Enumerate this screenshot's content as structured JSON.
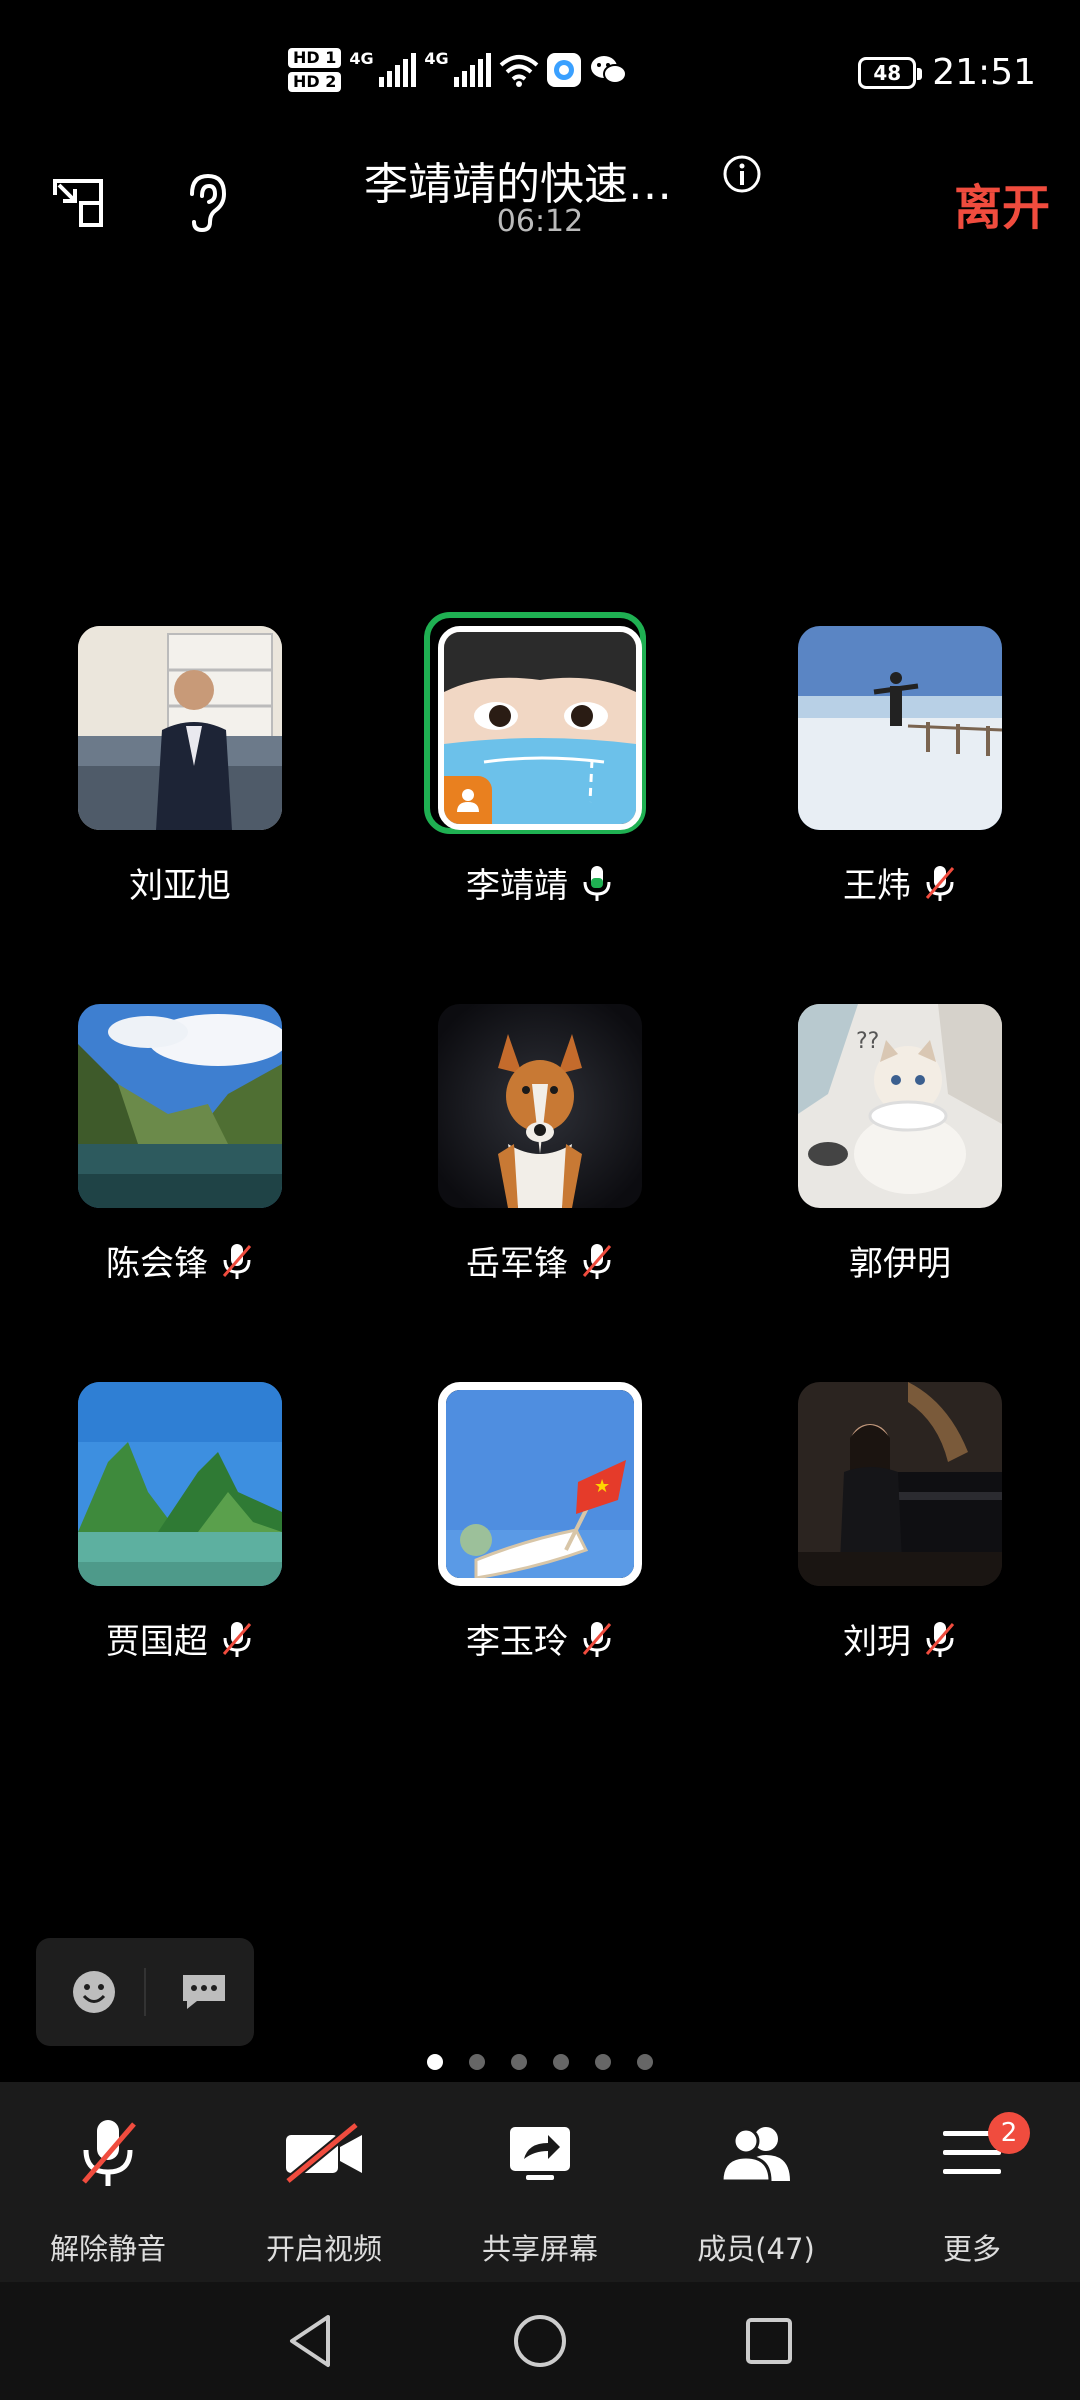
{
  "status_bar": {
    "hd1": "HD 1",
    "hd2": "HD 2",
    "net1": "4G",
    "net2": "4G",
    "battery": "48",
    "time": "21:51"
  },
  "header": {
    "title": "李靖靖的快速…",
    "duration": "06:12",
    "leave_label": "离开"
  },
  "participants": [
    {
      "name": "刘亚旭",
      "mic": "none",
      "avatar": "photo-man-in-room"
    },
    {
      "name": "李靖靖",
      "mic": "on",
      "avatar": "photo-child-mask",
      "host": true,
      "speaking": true
    },
    {
      "name": "王炜",
      "mic": "muted",
      "avatar": "photo-snow-field"
    },
    {
      "name": "陈会锋",
      "mic": "muted",
      "avatar": "photo-mountain-lake"
    },
    {
      "name": "岳军锋",
      "mic": "muted",
      "avatar": "photo-dog"
    },
    {
      "name": "郭伊明",
      "mic": "none",
      "avatar": "photo-cat"
    },
    {
      "name": "贾国超",
      "mic": "muted",
      "avatar": "photo-karst-hills"
    },
    {
      "name": "李玉玲",
      "mic": "muted",
      "avatar": "illustration-flag"
    },
    {
      "name": "刘玥",
      "mic": "muted",
      "avatar": "photo-pianist"
    }
  ],
  "pager": {
    "total": 6,
    "active": 1
  },
  "toolbar": {
    "unmute_label": "解除静音",
    "video_label": "开启视频",
    "share_label": "共享屏幕",
    "members_label": "成员(47)",
    "more_label": "更多",
    "more_badge": "2"
  },
  "colors": {
    "accent_red": "#f04c3e",
    "speaking_green": "#1fb052",
    "host_orange": "#e9801f"
  }
}
